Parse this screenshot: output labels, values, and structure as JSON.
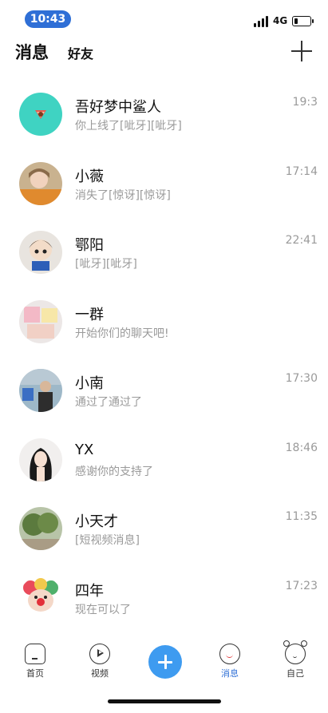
{
  "status_bar": {
    "time": "10:43",
    "network": "4G"
  },
  "header": {
    "tab_messages": "消息",
    "tab_friends": "好友"
  },
  "chats": [
    {
      "name": "吾好梦中鲨人",
      "preview": "你上线了[呲牙][呲牙]",
      "time": "19:3"
    },
    {
      "name": "小薇",
      "preview": "消失了[惊讶][惊讶]",
      "time": "17:14"
    },
    {
      "name": "鄂阳",
      "preview": "[呲牙][呲牙]",
      "time": "22:41"
    },
    {
      "name": "一群",
      "preview": "开始你们的聊天吧!",
      "time": ""
    },
    {
      "name": "小南",
      "preview": "通过了通过了",
      "time": "17:30"
    },
    {
      "name": "YX",
      "preview": "感谢你的支持了",
      "time": "18:46"
    },
    {
      "name": "小天才",
      "preview": "[短视频消息]",
      "time": "11:35"
    },
    {
      "name": "四年",
      "preview": "现在可以了",
      "time": "17:23"
    }
  ],
  "bottom_nav": {
    "home": "首页",
    "video": "视频",
    "messages": "消息",
    "me": "自己"
  },
  "colors": {
    "accent": "#2f6fd6",
    "fab": "#3e9bf0",
    "secondary_text": "#9a9a9a"
  }
}
